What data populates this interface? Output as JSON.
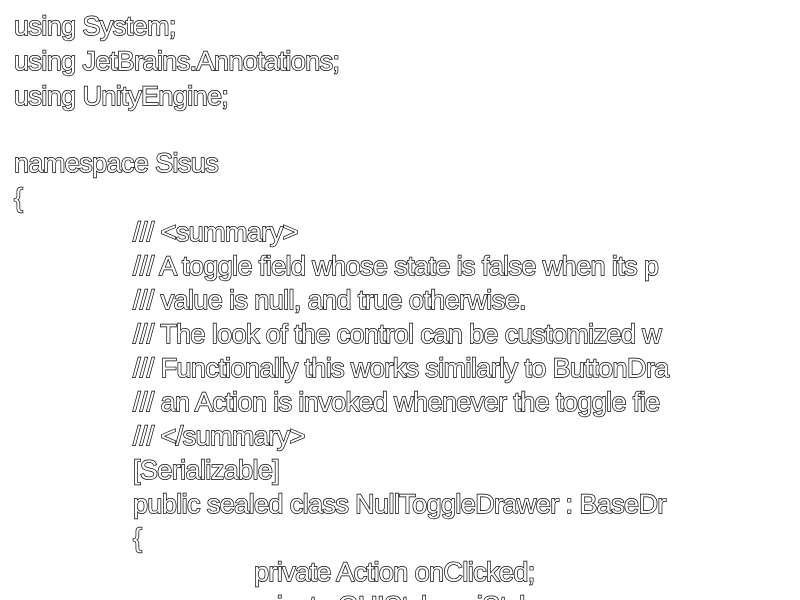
{
  "code": {
    "lines": [
      "using System;",
      "using JetBrains.Annotations;",
      "using UnityEngine;",
      "",
      "namespace Sisus",
      "{",
      "/// <summary>",
      "/// A toggle field whose state is false when its p",
      "/// value is null, and true otherwise.",
      "/// The look of the control can be customized w",
      "/// Functionally this works similarly to ButtonDra",
      "/// an Action is invoked whenever the toggle fie",
      "/// </summary>",
      "[Serializable]",
      "public sealed class NullToggleDrawer : BaseDr",
      "{",
      "private Action onClicked;",
      "private GUIStyle guiStyle;"
    ]
  }
}
